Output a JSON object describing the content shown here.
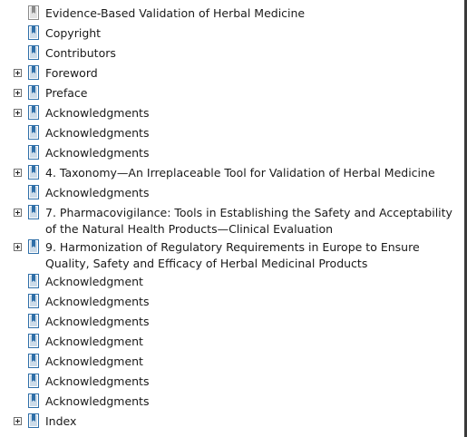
{
  "bookmarks": [
    {
      "label": "Evidence-Based Validation of Herbal Medicine",
      "expandable": false,
      "icon": "bookmark-gray-icon"
    },
    {
      "label": "Copyright",
      "expandable": false,
      "icon": "bookmark-icon"
    },
    {
      "label": "Contributors",
      "expandable": false,
      "icon": "bookmark-icon"
    },
    {
      "label": "Foreword",
      "expandable": true,
      "icon": "bookmark-icon"
    },
    {
      "label": "Preface",
      "expandable": true,
      "icon": "bookmark-icon"
    },
    {
      "label": "Acknowledgments",
      "expandable": true,
      "icon": "bookmark-icon"
    },
    {
      "label": "Acknowledgments",
      "expandable": false,
      "icon": "bookmark-icon"
    },
    {
      "label": "Acknowledgments",
      "expandable": false,
      "icon": "bookmark-icon"
    },
    {
      "label": "4. Taxonomy—An Irreplaceable Tool for Validation of Herbal Medicine",
      "expandable": true,
      "icon": "bookmark-icon"
    },
    {
      "label": "Acknowledgments",
      "expandable": false,
      "icon": "bookmark-icon"
    },
    {
      "label": "7. Pharmacovigilance: Tools in Establishing the Safety and Acceptability of the Natural Health Products—Clinical Evaluation",
      "expandable": true,
      "icon": "bookmark-icon"
    },
    {
      "label": "9. Harmonization of Regulatory Requirements in Europe to Ensure Quality, Safety and Efficacy of Herbal Medicinal Products",
      "expandable": true,
      "icon": "bookmark-icon"
    },
    {
      "label": "Acknowledgment",
      "expandable": false,
      "icon": "bookmark-icon"
    },
    {
      "label": "Acknowledgments",
      "expandable": false,
      "icon": "bookmark-icon"
    },
    {
      "label": "Acknowledgments",
      "expandable": false,
      "icon": "bookmark-icon"
    },
    {
      "label": "Acknowledgment",
      "expandable": false,
      "icon": "bookmark-icon"
    },
    {
      "label": "Acknowledgment",
      "expandable": false,
      "icon": "bookmark-icon"
    },
    {
      "label": "Acknowledgments",
      "expandable": false,
      "icon": "bookmark-icon"
    },
    {
      "label": "Acknowledgments",
      "expandable": false,
      "icon": "bookmark-icon"
    },
    {
      "label": "Index",
      "expandable": true,
      "icon": "bookmark-icon"
    }
  ],
  "colors": {
    "icon_blue": "#2f6fa8",
    "icon_gray": "#8a8a8a",
    "text": "#1a1a1a"
  }
}
